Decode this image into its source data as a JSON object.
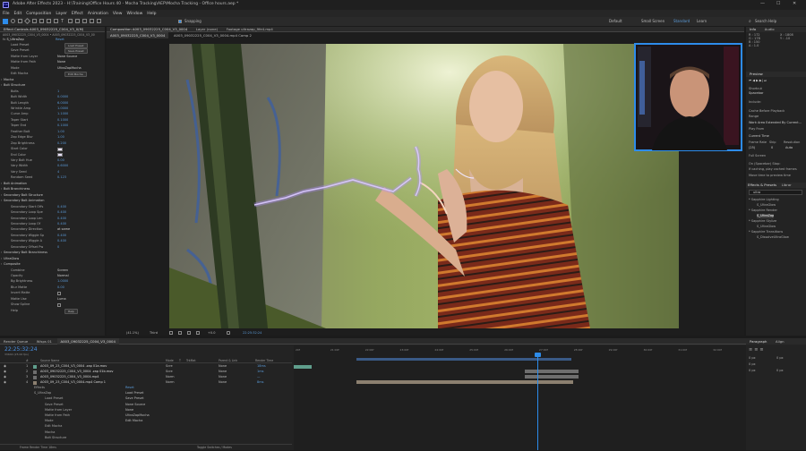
{
  "app": {
    "title": "Adobe After Effects 2023 - H:\\Training\\Office Hours 40 - Mocha Tracking\\AEP\\Mocha Tracking - Office hours.aep *",
    "menus": [
      "File",
      "Edit",
      "Composition",
      "Layer",
      "Effect",
      "Animation",
      "View",
      "Window",
      "Help"
    ],
    "workspace": [
      "Default",
      "Small Screen",
      "Standard",
      "Learn"
    ],
    "search_placeholder": "Search Help",
    "snapping": "Snapping",
    "window_controls": [
      "—",
      "☐",
      "✕"
    ]
  },
  "effect_controls": {
    "tab": "Effect Controls A003_09032225_C004_V3_0(M)",
    "breadcrumb": "A003_09032225_C004_V3_0004 • A003_09032225_C004_V3_00",
    "effect_name": "S_UltraZap",
    "reset": "Reset",
    "rows": [
      {
        "label": "Load Preset",
        "value": "Load Preset",
        "kind": "btn"
      },
      {
        "label": "Save Preset",
        "value": "Save Preset",
        "kind": "btn"
      },
      {
        "label": "Matte from Layer",
        "value": "None      Source",
        "kind": "text"
      },
      {
        "label": "Matte from Path",
        "value": "None",
        "kind": "text"
      },
      {
        "label": "Mode",
        "value": "UltraZapMocha",
        "kind": "text"
      },
      {
        "label": "Edit Mocha",
        "value": "Edit Mocha",
        "kind": "btn"
      },
      {
        "label": "Mocha",
        "value": "",
        "kind": "group"
      },
      {
        "label": "Bolt Structure",
        "value": "",
        "kind": "group"
      },
      {
        "label": "Bolts",
        "value": "1",
        "kind": "num"
      },
      {
        "label": "Bolt Width",
        "value": "0.0000",
        "kind": "num"
      },
      {
        "label": "Bolt Length",
        "value": "6.0000",
        "kind": "num"
      },
      {
        "label": "Wrinkle Amp",
        "value": "1.0000",
        "kind": "num"
      },
      {
        "label": "Curve Amp",
        "value": "1.1000",
        "kind": "num"
      },
      {
        "label": "Taper Start",
        "value": "0.1000",
        "kind": "num"
      },
      {
        "label": "Taper End",
        "value": "0.1000",
        "kind": "num"
      },
      {
        "label": "Feather Bolt",
        "value": "1.00",
        "kind": "num"
      },
      {
        "label": "Zap Edge Blur",
        "value": "1.00",
        "kind": "num"
      },
      {
        "label": "Zap Brightness",
        "value": "0.200",
        "kind": "num"
      },
      {
        "label": "Start Color",
        "value": "",
        "kind": "color"
      },
      {
        "label": "End Color",
        "value": "",
        "kind": "color"
      },
      {
        "label": "Vary Bolt Hue",
        "value": "0.00",
        "kind": "num"
      },
      {
        "label": "Vary Width",
        "value": "0.6000",
        "kind": "num"
      },
      {
        "label": "Vary Seed",
        "value": "4",
        "kind": "num"
      },
      {
        "label": "Random Seed",
        "value": "0.123",
        "kind": "num"
      },
      {
        "label": "Bolt Animation",
        "value": "",
        "kind": "group"
      },
      {
        "label": "Bolt Branchiness",
        "value": "",
        "kind": "group"
      },
      {
        "label": "Secondary Bolt Structure",
        "value": "",
        "kind": "group"
      },
      {
        "label": "Secondary Bolt Animation",
        "value": "",
        "kind": "group"
      },
      {
        "label": "Secondary Start Offs",
        "value": "0.400",
        "kind": "num"
      },
      {
        "label": "Secondary Loop Spe",
        "value": "0.400",
        "kind": "num"
      },
      {
        "label": "Secondary Loop Len",
        "value": "0.400",
        "kind": "num"
      },
      {
        "label": "Secondary Loop Of",
        "value": "0.400",
        "kind": "num"
      },
      {
        "label": "Secondary Direction",
        "value": "at same",
        "kind": "text"
      },
      {
        "label": "Secondary Wiggle Sp",
        "value": "0.400",
        "kind": "num"
      },
      {
        "label": "Secondary Wiggle A",
        "value": "0.400",
        "kind": "num"
      },
      {
        "label": "Secondary Offset Pw",
        "value": "0",
        "kind": "num"
      },
      {
        "label": "Secondary Bolt Branchiness",
        "value": "",
        "kind": "group"
      },
      {
        "label": "UltraGlow",
        "value": "",
        "kind": "group"
      },
      {
        "label": "Composite",
        "value": "",
        "kind": "group"
      },
      {
        "label": "Combine",
        "value": "Screen",
        "kind": "text"
      },
      {
        "label": "Opacity",
        "value": "Normal",
        "kind": "text"
      },
      {
        "label": "Bg Brightness",
        "value": "1.0000",
        "kind": "num"
      },
      {
        "label": "Blur Matte",
        "value": "0.00",
        "kind": "num"
      },
      {
        "label": "Invert Matte",
        "value": "",
        "kind": "check"
      },
      {
        "label": "Matte Use",
        "value": "Luma",
        "kind": "text"
      },
      {
        "label": "Show Spline",
        "value": "",
        "kind": "check"
      },
      {
        "label": "Help",
        "value": "Help",
        "kind": "btn"
      }
    ]
  },
  "composition": {
    "tabs": [
      "Composition A003_09032225_C004_V3_0004",
      "Layer (none)",
      "Footage ultrazap_9fe4.mp4"
    ],
    "subtabs": [
      "A003_09032225_C004_V3_0004",
      "A003_09032225_C004_V3_0004.mp4 Comp 2"
    ],
    "zoom": "(41.1%)",
    "resolution": "Third",
    "exposure": "+0.0",
    "timecode": "22:25:32:24",
    "bottom_icons": [
      "grid-icon",
      "mask-icon",
      "region-icon",
      "transparency-icon",
      "camera-icon",
      "show-channel-icon"
    ]
  },
  "info_panel": {
    "tabs": [
      "Info",
      "Audio"
    ],
    "values": [
      "R : 172",
      "G : 178",
      "B : 150",
      "A : 1.0",
      "X : 1808",
      "Y : -10"
    ]
  },
  "preview": {
    "title": "Preview",
    "shortcut_label": "Shortcut",
    "shortcut": "Spacebar",
    "include": "Include:",
    "cache_before": "Cache Before Playback",
    "range_label": "Range",
    "range": "Work Area Extended By Current...",
    "play_from_label": "Play From",
    "play_from": "Current Time",
    "frame_rate": "Frame Rate",
    "skip": "Skip",
    "resolution": "Resolution",
    "frame_rate_val": "(25)",
    "skip_val": "0",
    "resolution_val": "Auto",
    "full_screen": "Full Screen",
    "on_stop": "On (Spacebar) Stop:",
    "if_caching": "If caching, play cached frames",
    "move_time": "Move time to preview time"
  },
  "effects_presets": {
    "tabs": [
      "Effects & Presets",
      "Librar"
    ],
    "search": "ultra",
    "tree": [
      "* Sapphire Lighting",
      "S_UltraGlow",
      "* Sapphire Render",
      "S_UltraZap",
      "* Sapphire Stylize",
      "S_UltraGlow",
      "* Sapphire Transitions",
      "S_DissolveUltraGlow"
    ]
  },
  "timeline": {
    "tabs": [
      "Render Queue",
      "Wisps 01",
      "A003_09032225_C004_V3_0004"
    ],
    "timecode": "22:25:32:24",
    "frame_info": "33640 (25.00 fps)",
    "headers": [
      "#",
      "Source Name",
      "Mode",
      "T",
      "TrkMat",
      "Parent & Link",
      "Render Time"
    ],
    "layers": [
      {
        "num": "1",
        "name": "A003_09_23_C004_V3_0004 .zap 01a.mov",
        "mode": "Scre",
        "parent": "None",
        "time": "18ms"
      },
      {
        "num": "2",
        "name": "A003_09032225_C004_V3_0004 .zap 01b.mov",
        "mode": "Scre",
        "parent": "None",
        "time": "1ms"
      },
      {
        "num": "3",
        "name": "A003_09032225_C004_V3_0004.mp4",
        "mode": "Norm",
        "parent": "None",
        "time": "—"
      },
      {
        "num": "4",
        "name": "A003_09_23_C004_V3_0004.mp4 Comp 1",
        "mode": "Norm",
        "parent": "None",
        "time": "8ms"
      }
    ],
    "sub_rows": [
      "Effects",
      "S_UltraZap",
      "Load Preset",
      "Save Preset",
      "Matte from Layer",
      "Matte from Path",
      "Mode",
      "Edit Mocha",
      "Mocha",
      "Bolt Structure"
    ],
    "sub_values": [
      "Reset",
      "Load Preset",
      "Save Preset",
      "None    Source",
      "None",
      "UltraZapMocha",
      "Edit Mocha",
      "",
      "",
      ""
    ],
    "ruler": [
      "20f",
      "21:00f",
      "22:00f",
      "23:00f",
      "24:00f",
      "25:00f",
      "26:00f",
      "27:00f",
      "28:00f",
      "29:00f",
      "30:00f",
      "31:00f",
      "32:00f"
    ],
    "footer": "Frame Render Time  18ms",
    "toggle": "Toggle Switches / Modes"
  },
  "paragraph_panel": {
    "tabs": [
      "Paragraph",
      "Align"
    ],
    "values": [
      "0 px",
      "0 px",
      "0 px",
      "0 px",
      "0 px"
    ]
  },
  "colors": {
    "accent": "#2d8ceb",
    "layer_bar": "#5f9e8c",
    "work_area": "#3a5a86",
    "bar_grey": "#6e6e6e",
    "bar_tan": "#8c8070"
  }
}
